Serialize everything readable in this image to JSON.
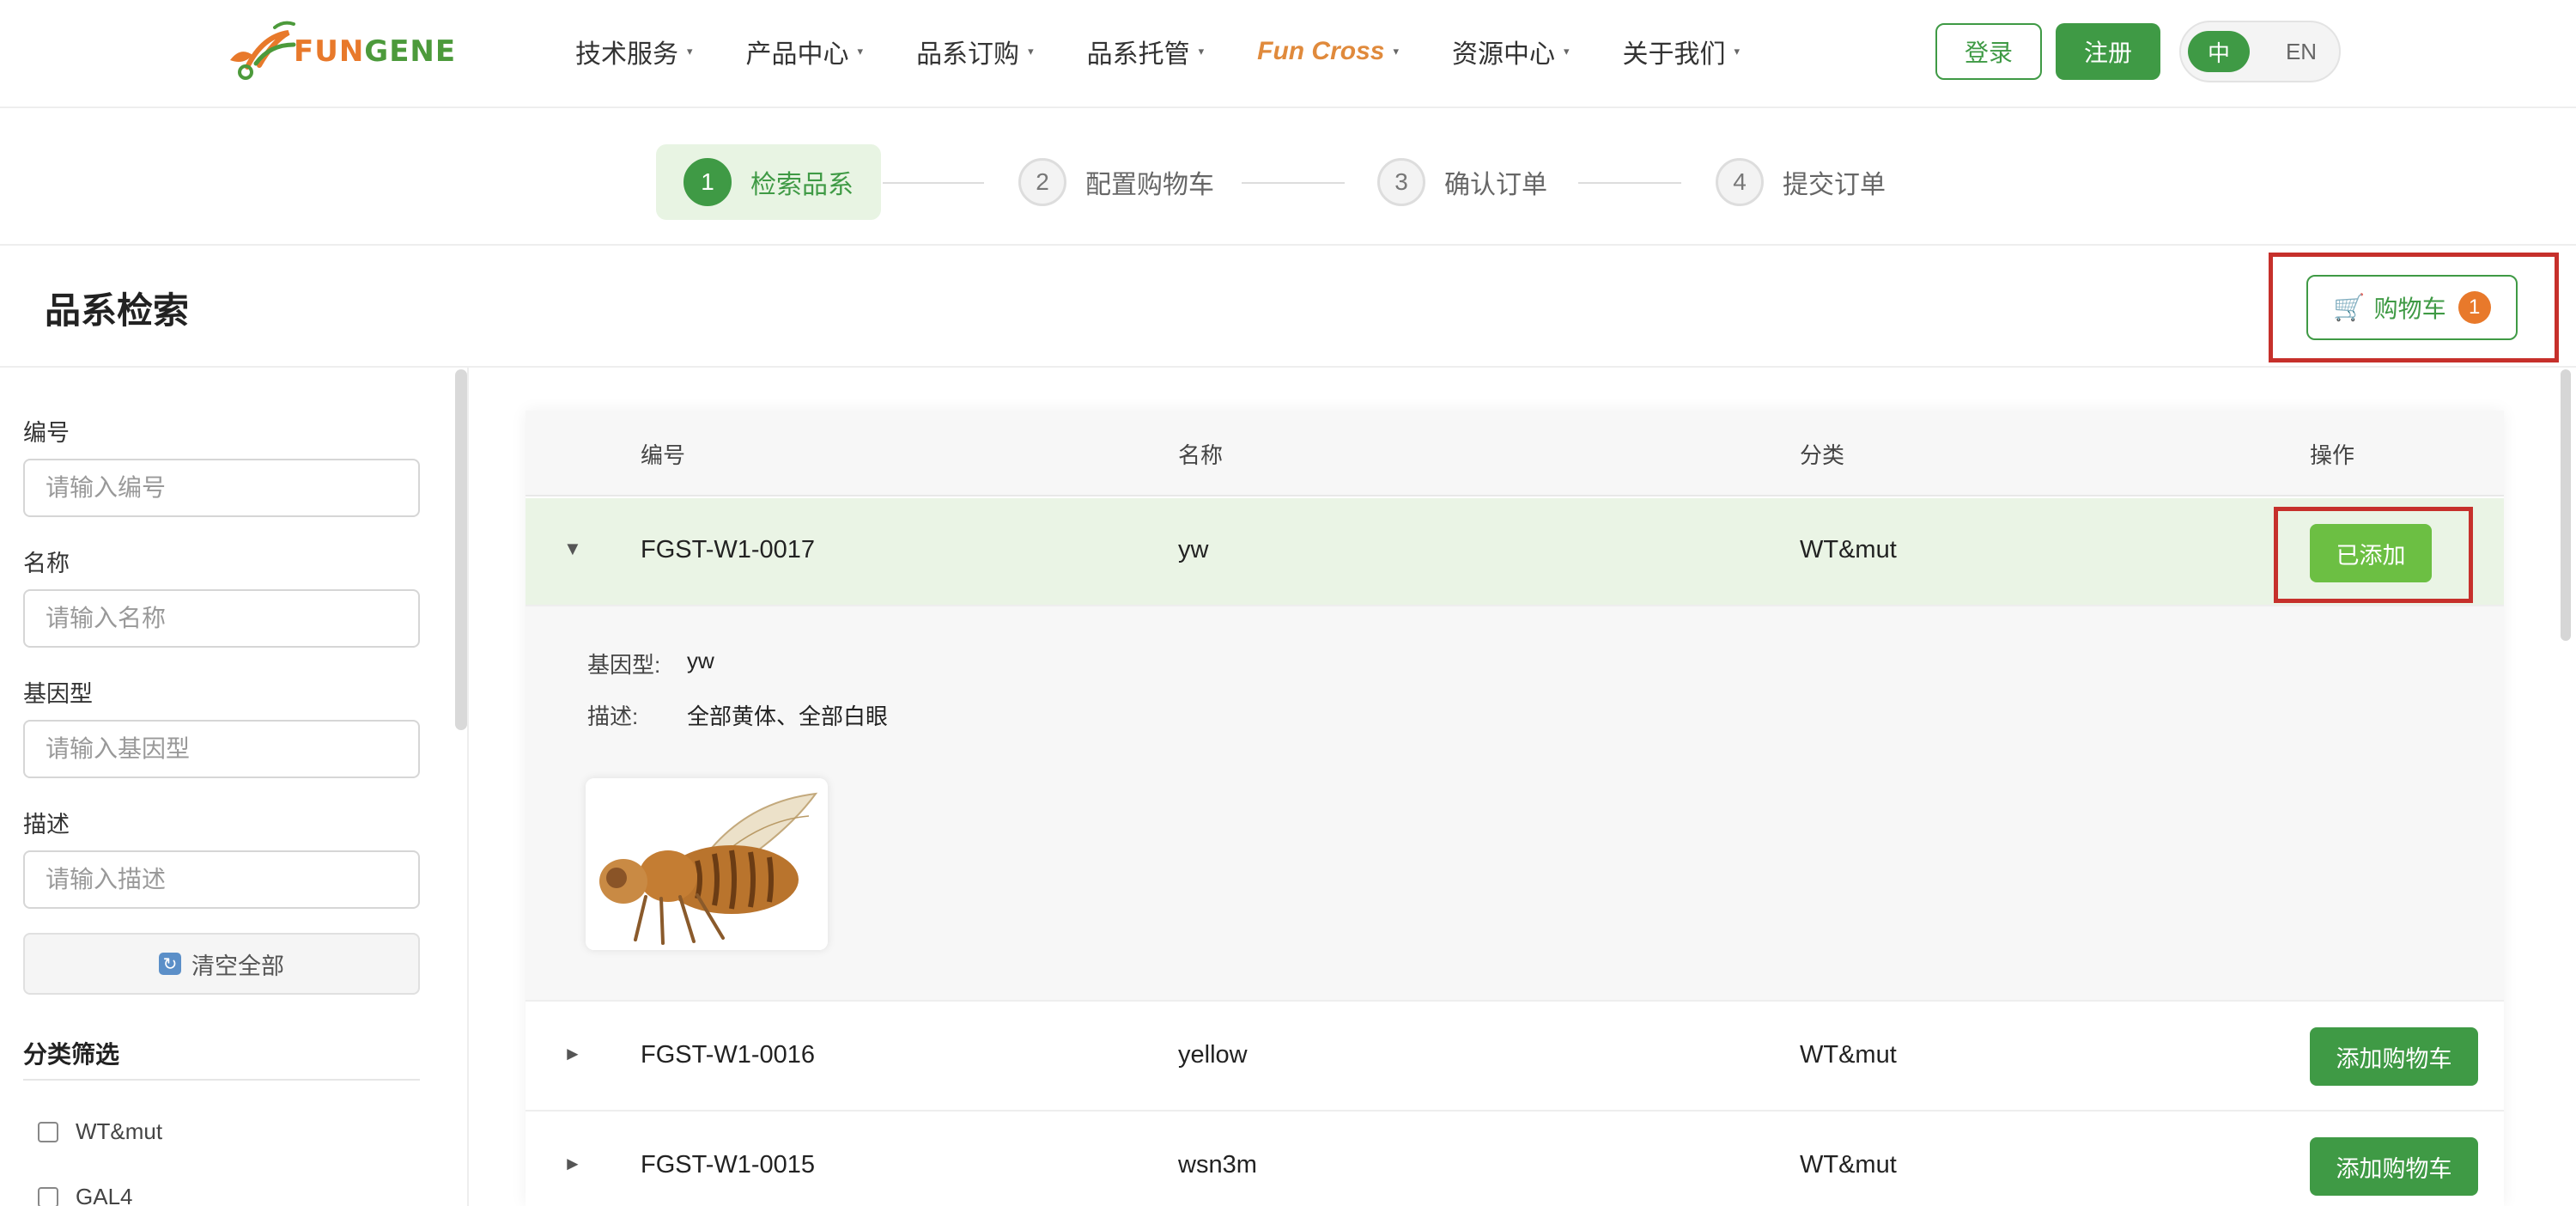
{
  "brand": {
    "logo_prefix": "FUN",
    "logo_suffix": "GENE"
  },
  "nav": [
    {
      "label": "技术服务",
      "caret": "▾"
    },
    {
      "label": "产品中心",
      "caret": "▾"
    },
    {
      "label": "品系订购",
      "caret": "▾"
    },
    {
      "label": "品系托管",
      "caret": "▾"
    },
    {
      "label": "Fun Cross",
      "caret": "▾"
    },
    {
      "label": "资源中心",
      "caret": "▾"
    },
    {
      "label": "关于我们",
      "caret": "▾"
    }
  ],
  "auth": {
    "login": "登录",
    "register": "注册"
  },
  "lang": {
    "zh": "中",
    "en": "EN",
    "selected": "中"
  },
  "steps": [
    {
      "num": "1",
      "label": "检索品系",
      "active": true
    },
    {
      "num": "2",
      "label": "配置购物车",
      "active": false
    },
    {
      "num": "3",
      "label": "确认订单",
      "active": false
    },
    {
      "num": "4",
      "label": "提交订单",
      "active": false
    }
  ],
  "page": {
    "title": "品系检索"
  },
  "cart": {
    "label": "购物车",
    "count": "1",
    "icon": "cart-icon"
  },
  "filters": {
    "fields": [
      {
        "label": "编号",
        "placeholder": "请输入编号",
        "value": ""
      },
      {
        "label": "名称",
        "placeholder": "请输入名称",
        "value": ""
      },
      {
        "label": "基因型",
        "placeholder": "请输入基因型",
        "value": ""
      },
      {
        "label": "描述",
        "placeholder": "请输入描述",
        "value": ""
      }
    ],
    "clear_label": "清空全部",
    "category_title": "分类筛选",
    "categories": [
      {
        "label": "WT&mut",
        "checked": false
      },
      {
        "label": "GAL4",
        "checked": false
      }
    ]
  },
  "table": {
    "headers": {
      "id": "编号",
      "name": "名称",
      "category": "分类",
      "action": "操作"
    },
    "rows": [
      {
        "arrow": "▼",
        "id": "FGST-W1-0017",
        "name": "yw",
        "category": "WT&mut",
        "action": "已添加",
        "expanded": true
      },
      {
        "arrow": "►",
        "id": "FGST-W1-0016",
        "name": "yellow",
        "category": "WT&mut",
        "action": "添加购物车",
        "expanded": false
      },
      {
        "arrow": "►",
        "id": "FGST-W1-0015",
        "name": "wsn3m",
        "category": "WT&mut",
        "action": "添加购物车",
        "expanded": false
      }
    ],
    "detail": {
      "genotype_label": "基因型:",
      "genotype": "yw",
      "desc_label": "描述:",
      "desc": "全部黄体、全部白眼"
    }
  },
  "colors": {
    "brand_green": "#3f9a45",
    "added_green": "#6cbf43",
    "brand_orange": "#e8792b",
    "highlight_red": "#c6302b"
  }
}
